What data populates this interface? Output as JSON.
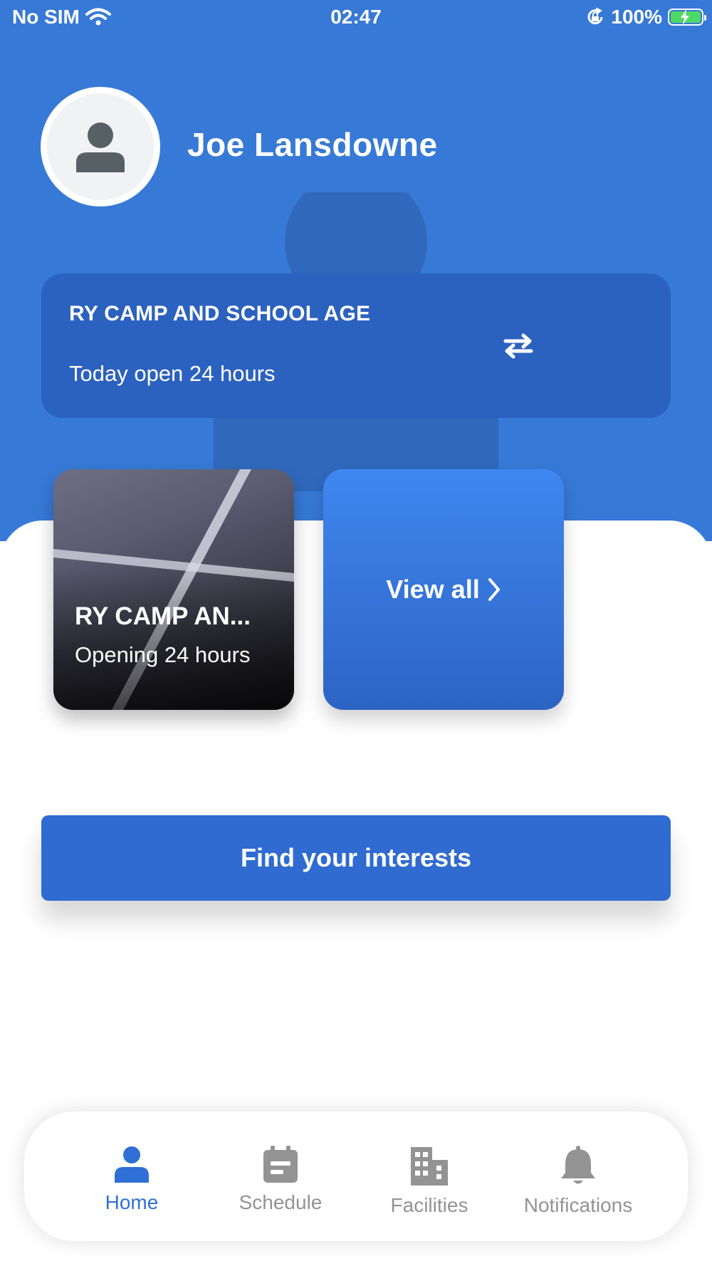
{
  "status_bar": {
    "carrier": "No SIM",
    "time": "02:47",
    "battery": "100%",
    "battery_level": 1.0,
    "icons": [
      "wifi-icon",
      "orientation-lock-icon",
      "battery-charging-icon"
    ]
  },
  "profile": {
    "name": "Joe Lansdowne",
    "avatar_icon": "user-icon"
  },
  "facility_card": {
    "name": "RY CAMP AND SCHOOL AGE",
    "hours": "Today open 24 hours",
    "switch_icon": "swap-arrows-icon"
  },
  "facility_tiles": [
    {
      "title": "RY CAMP AN...",
      "subtitle": "Opening 24 hours"
    }
  ],
  "view_all": {
    "label": "View all",
    "icon": "chevron-right-icon"
  },
  "cta": {
    "label": "Find your interests"
  },
  "tabs": [
    {
      "label": "Home",
      "icon": "person-icon",
      "active": true
    },
    {
      "label": "Schedule",
      "icon": "calendar-icon",
      "active": false
    },
    {
      "label": "Facilities",
      "icon": "building-icon",
      "active": false
    },
    {
      "label": "Notifications",
      "icon": "bell-icon",
      "active": false
    }
  ],
  "colors": {
    "brand_blue": "#3779d6",
    "card_blue": "#2c62bf",
    "active_tab": "#2f6fd6",
    "inactive_tab": "#939393"
  }
}
